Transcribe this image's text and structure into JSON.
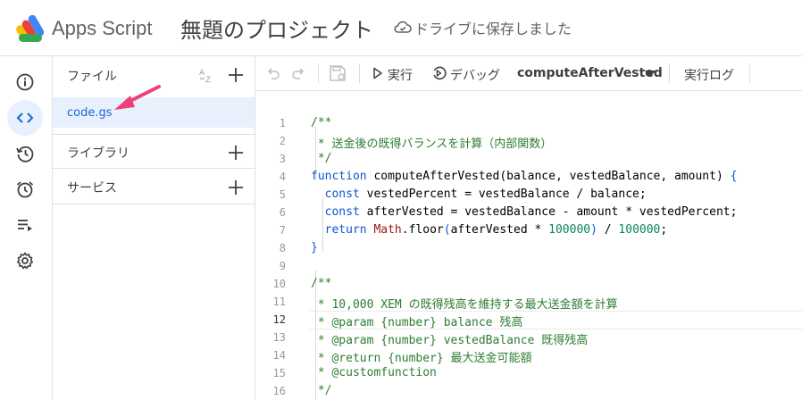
{
  "header": {
    "app_name": "Apps Script",
    "project_title": "無題のプロジェクト",
    "save_status": "ドライブに保存しました"
  },
  "rail": {
    "items": [
      {
        "name": "overview",
        "icon": "info-icon"
      },
      {
        "name": "editor",
        "icon": "code-icon",
        "active": true
      },
      {
        "name": "history",
        "icon": "history-icon"
      },
      {
        "name": "triggers",
        "icon": "alarm-clock-icon"
      },
      {
        "name": "executions",
        "icon": "executions-list-icon"
      },
      {
        "name": "settings",
        "icon": "gear-icon"
      }
    ]
  },
  "files_panel": {
    "header": "ファイル",
    "file": "code.gs",
    "libraries": "ライブラリ",
    "services": "サービス"
  },
  "toolbar": {
    "run_label": "実行",
    "debug_label": "デバッグ",
    "function_selected": "computeAfterVested",
    "log_label": "実行ログ"
  },
  "editor": {
    "current_line": 12,
    "line_numbers": [
      "1",
      "2",
      "3",
      "4",
      "5",
      "6",
      "7",
      "8",
      "9",
      "10",
      "11",
      "12",
      "13",
      "14",
      "15",
      "16"
    ],
    "lines": [
      [
        {
          "t": "/**",
          "c": "cm"
        }
      ],
      [
        {
          "t": " * 送金後の既得バランスを計算（内部関数）",
          "c": "cm"
        }
      ],
      [
        {
          "t": " */",
          "c": "cm"
        }
      ],
      [
        {
          "t": "function",
          "c": "kw2"
        },
        {
          "t": " computeAfterVested(balance, vestedBalance, amount) ",
          "c": "fn"
        },
        {
          "t": "{",
          "c": "kw2"
        }
      ],
      [
        {
          "t": "  ",
          "c": "fn"
        },
        {
          "t": "const",
          "c": "kw2"
        },
        {
          "t": " vestedPercent = vestedBalance / balance;",
          "c": "fn"
        }
      ],
      [
        {
          "t": "  ",
          "c": "fn"
        },
        {
          "t": "const",
          "c": "kw2"
        },
        {
          "t": " afterVested = vestedBalance - amount * vestedPercent;",
          "c": "fn"
        }
      ],
      [
        {
          "t": "  ",
          "c": "fn"
        },
        {
          "t": "return",
          "c": "kw2"
        },
        {
          "t": " ",
          "c": "fn"
        },
        {
          "t": "Math",
          "c": "cls"
        },
        {
          "t": ".floor",
          "c": "fn"
        },
        {
          "t": "(",
          "c": "kw2"
        },
        {
          "t": "afterVested * ",
          "c": "fn"
        },
        {
          "t": "100000",
          "c": "num"
        },
        {
          "t": ")",
          "c": "kw2"
        },
        {
          "t": " / ",
          "c": "fn"
        },
        {
          "t": "100000",
          "c": "num"
        },
        {
          "t": ";",
          "c": "fn"
        }
      ],
      [
        {
          "t": "}",
          "c": "kw2"
        }
      ],
      [
        {
          "t": "",
          "c": "fn"
        }
      ],
      [
        {
          "t": "/**",
          "c": "cm"
        }
      ],
      [
        {
          "t": " * 10,000 XEM の既得残高を維持する最大送金額を計算",
          "c": "cm"
        }
      ],
      [
        {
          "t": " * @param {number} balance 残高",
          "c": "cm"
        }
      ],
      [
        {
          "t": " * @param {number} vestedBalance 既得残高",
          "c": "cm"
        }
      ],
      [
        {
          "t": " * @return {number} 最大送金可能額",
          "c": "cm"
        }
      ],
      [
        {
          "t": " * @customfunction",
          "c": "cm"
        }
      ],
      [
        {
          "t": " */",
          "c": "cm"
        }
      ]
    ]
  },
  "colors": {
    "accent": "#1967d2",
    "active_bg": "#e8f0fe",
    "annotation_arrow": "#f0407a"
  }
}
